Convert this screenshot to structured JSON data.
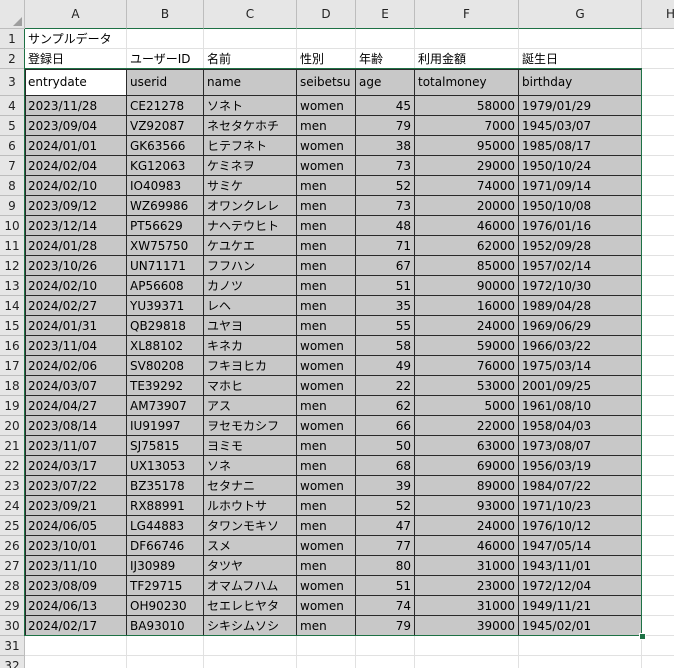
{
  "columns": [
    "A",
    "B",
    "C",
    "D",
    "E",
    "F",
    "G",
    "H"
  ],
  "row_numbers": [
    "1",
    "2",
    "3",
    "4",
    "5",
    "6",
    "7",
    "8",
    "9",
    "10",
    "11",
    "12",
    "13",
    "14",
    "15",
    "16",
    "17",
    "18",
    "19",
    "20",
    "21",
    "22",
    "23",
    "24",
    "25",
    "26",
    "27",
    "28",
    "29",
    "30",
    "31",
    "32"
  ],
  "title_cell": "サンプルデータ",
  "jp_headers": [
    "登録日",
    "ユーザーID",
    "名前",
    "性別",
    "年齢",
    "利用金額",
    "誕生日"
  ],
  "en_headers": [
    "entrydate",
    "userid",
    "name",
    "seibetsu",
    "age",
    "totalmoney",
    "birthday"
  ],
  "rows": [
    [
      "2023/11/28",
      "CE21278",
      "ソネト",
      "women",
      "45",
      "58000",
      "1979/01/29"
    ],
    [
      "2023/09/04",
      "VZ92087",
      "ネセタケホチ",
      "men",
      "79",
      "7000",
      "1945/03/07"
    ],
    [
      "2024/01/01",
      "GK63566",
      "ヒテフネト",
      "women",
      "38",
      "95000",
      "1985/08/17"
    ],
    [
      "2024/02/04",
      "KG12063",
      "ケミネヲ",
      "women",
      "73",
      "29000",
      "1950/10/24"
    ],
    [
      "2024/02/10",
      "IO40983",
      "サミケ",
      "men",
      "52",
      "74000",
      "1971/09/14"
    ],
    [
      "2023/09/12",
      "WZ69986",
      "オワンクレレ",
      "men",
      "73",
      "20000",
      "1950/10/08"
    ],
    [
      "2023/12/14",
      "PT56629",
      "ナヘテウヒト",
      "men",
      "48",
      "46000",
      "1976/01/16"
    ],
    [
      "2024/01/28",
      "XW75750",
      "ケユケエ",
      "men",
      "71",
      "62000",
      "1952/09/28"
    ],
    [
      "2023/10/26",
      "UN71171",
      "フフハン",
      "men",
      "67",
      "85000",
      "1957/02/14"
    ],
    [
      "2024/02/10",
      "AP56608",
      "カノツ",
      "men",
      "51",
      "90000",
      "1972/10/30"
    ],
    [
      "2024/02/27",
      "YU39371",
      "レヘ",
      "men",
      "35",
      "16000",
      "1989/04/28"
    ],
    [
      "2024/01/31",
      "QB29818",
      "ユヤヨ",
      "men",
      "55",
      "24000",
      "1969/06/29"
    ],
    [
      "2023/11/04",
      "XL88102",
      "キネカ",
      "women",
      "58",
      "59000",
      "1966/03/22"
    ],
    [
      "2024/02/06",
      "SV80208",
      "フキヨヒカ",
      "women",
      "49",
      "76000",
      "1975/03/14"
    ],
    [
      "2024/03/07",
      "TE39292",
      "マホヒ",
      "women",
      "22",
      "53000",
      "2001/09/25"
    ],
    [
      "2024/04/27",
      "AM73907",
      "アス",
      "men",
      "62",
      "5000",
      "1961/08/10"
    ],
    [
      "2023/08/14",
      "IU91997",
      "ヲセモカシフ",
      "women",
      "66",
      "22000",
      "1958/04/03"
    ],
    [
      "2023/11/07",
      "SJ75815",
      "ヨミモ",
      "men",
      "50",
      "63000",
      "1973/08/07"
    ],
    [
      "2024/03/17",
      "UX13053",
      "ソネ",
      "men",
      "68",
      "69000",
      "1956/03/19"
    ],
    [
      "2023/07/22",
      "BZ35178",
      "セタナニ",
      "women",
      "39",
      "89000",
      "1984/07/22"
    ],
    [
      "2023/09/21",
      "RX88991",
      "ルホウトサ",
      "men",
      "52",
      "93000",
      "1971/10/23"
    ],
    [
      "2024/06/05",
      "LG44883",
      "タワンモキソ",
      "men",
      "47",
      "24000",
      "1976/10/12"
    ],
    [
      "2023/10/01",
      "DF66746",
      "スメ",
      "women",
      "77",
      "46000",
      "1947/05/14"
    ],
    [
      "2023/11/10",
      "IJ30989",
      "タツヤ",
      "men",
      "80",
      "31000",
      "1943/11/01"
    ],
    [
      "2023/08/09",
      "TF29715",
      "オマムフハム",
      "women",
      "51",
      "23000",
      "1972/12/04"
    ],
    [
      "2024/06/13",
      "OH90230",
      "セエレヒヤタ",
      "women",
      "74",
      "31000",
      "1949/11/21"
    ],
    [
      "2024/02/17",
      "BA93010",
      "シキシムソシ",
      "men",
      "79",
      "39000",
      "1945/02/01"
    ]
  ],
  "colors": {
    "data_fill": "#c8c8c8",
    "grid": "#e1e1e1",
    "header_bg": "#e6e6e6",
    "selection": "#1e7145"
  }
}
